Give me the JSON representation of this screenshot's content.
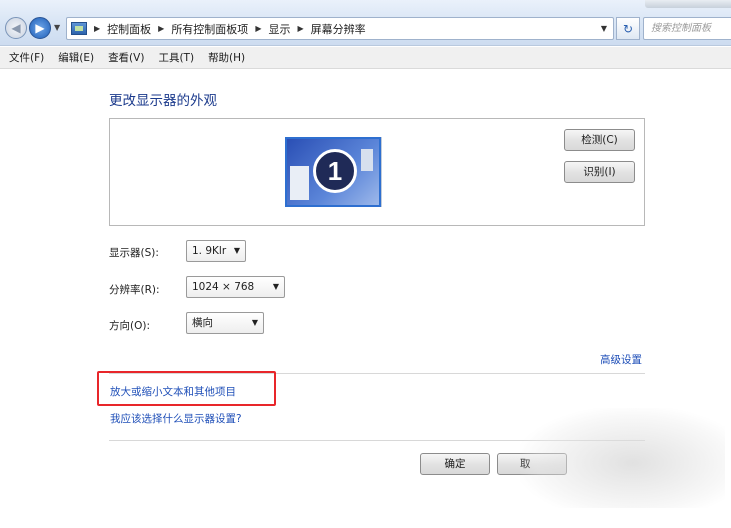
{
  "address_bar": {
    "back_glyph": "◀",
    "forward_glyph": "▶",
    "breadcrumbs": [
      "控制面板",
      "所有控制面板项",
      "显示",
      "屏幕分辨率"
    ],
    "search_placeholder": "搜索控制面板"
  },
  "menu": [
    "文件(F)",
    "编辑(E)",
    "查看(V)",
    "工具(T)",
    "帮助(H)"
  ],
  "main": {
    "title": "更改显示器的外观",
    "monitor_number": "1",
    "detect_button": "检测(C)",
    "identify_button": "识别(I)",
    "display_label": "显示器(S):",
    "display_value": "1. 9Klr",
    "resolution_label": "分辨率(R):",
    "resolution_value": "1024 × 768",
    "orientation_label": "方向(O):",
    "orientation_value": "横向",
    "advanced_link": "高级设置",
    "text_size_link": "放大或缩小文本和其他项目",
    "help_link": "我应该选择什么显示器设置?",
    "ok_button": "确定",
    "cancel_button": "取"
  },
  "colors": {
    "link": "#1f4fb8",
    "title": "#1b3a8c",
    "highlight_box": "#e8262a",
    "monitor_selected_border": "#2e6fd0"
  }
}
